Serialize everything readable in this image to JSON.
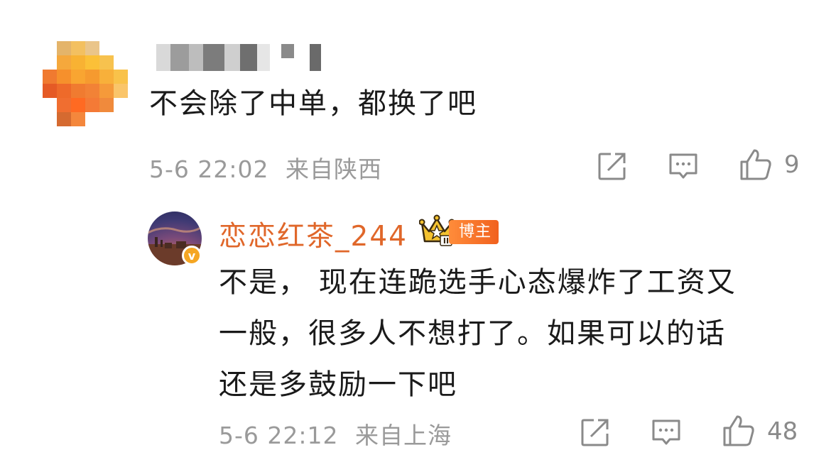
{
  "comment": {
    "text": "不会除了中单，都换了吧",
    "timestamp": "5-6 22:02",
    "location": "来自陕西",
    "likes": "9"
  },
  "reply": {
    "username": "恋恋红茶_244",
    "tag": "博主",
    "crown_level": "II",
    "verified_badge": "v",
    "text_lines": [
      "不是，  现在连跪选手心态爆炸了工资又",
      "一般，很多人不想打了。如果可以的话",
      "还是多鼓励一下吧"
    ],
    "timestamp": "5-6 22:12",
    "location": "来自上海",
    "likes": "48"
  },
  "colors": {
    "meta_gray": "#9a9a9a",
    "icon_gray": "#8a8a8a",
    "username_orange": "#e0672a",
    "tag_orange": "#f1611e",
    "badge_yellow": "#f5a623"
  },
  "icons": [
    "share-icon",
    "comment-icon",
    "like-icon",
    "crown-icon",
    "verified-badge-icon"
  ]
}
